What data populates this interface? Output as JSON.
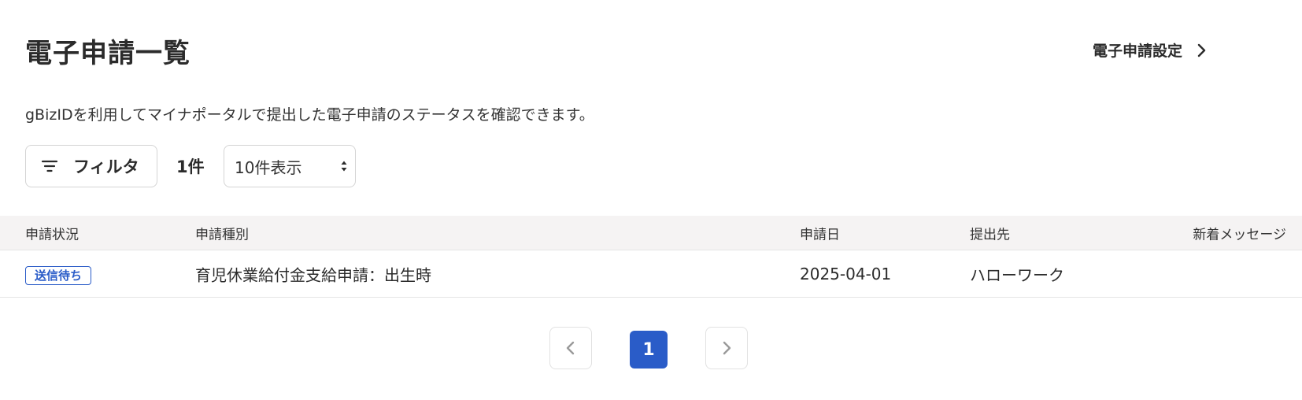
{
  "header": {
    "title": "電子申請一覧",
    "settings_label": "電子申請設定"
  },
  "description": "gBizIDを利用してマイナポータルで提出した電子申請のステータスを確認できます。",
  "toolbar": {
    "filter_label": "フィルタ",
    "count_label": "1件",
    "per_page_selected": "10件表示"
  },
  "table": {
    "columns": [
      "申請状況",
      "申請種別",
      "申請日",
      "提出先",
      "新着メッセージ"
    ],
    "rows": [
      {
        "status": "送信待ち",
        "type": "育児休業給付金支給申請：出生時",
        "date": "2025-04-01",
        "destination": "ハローワーク",
        "new_message": ""
      }
    ]
  },
  "pagination": {
    "current_page": "1"
  },
  "colors": {
    "accent": "#2a5cc8",
    "header_bg": "#f5f3f3",
    "text": "#2b2b2b"
  }
}
